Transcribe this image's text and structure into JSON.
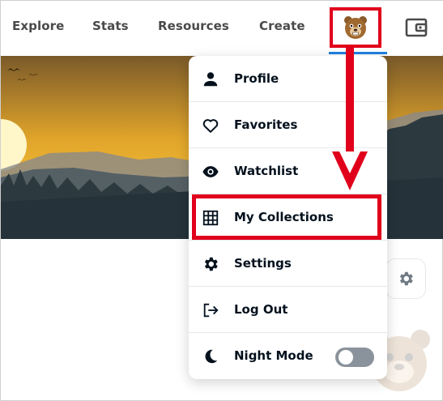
{
  "nav": {
    "links": [
      "Explore",
      "Stats",
      "Resources",
      "Create"
    ],
    "avatar_icon": "bear-avatar-icon",
    "wallet_icon": "wallet-icon",
    "accent_color": "#2081e2"
  },
  "menu": {
    "items": [
      {
        "label": "Profile",
        "icon": "person-icon"
      },
      {
        "label": "Favorites",
        "icon": "heart-icon"
      },
      {
        "label": "Watchlist",
        "icon": "eye-icon"
      },
      {
        "label": "My Collections",
        "icon": "grid-icon"
      },
      {
        "label": "Settings",
        "icon": "gear-icon"
      },
      {
        "label": "Log Out",
        "icon": "logout-icon"
      },
      {
        "label": "Night Mode",
        "icon": "moon-icon",
        "toggle": false
      }
    ],
    "highlighted_item": "My Collections"
  },
  "annotation": {
    "color": "#e0001b",
    "arrow_icon": "down-arrow-icon"
  }
}
